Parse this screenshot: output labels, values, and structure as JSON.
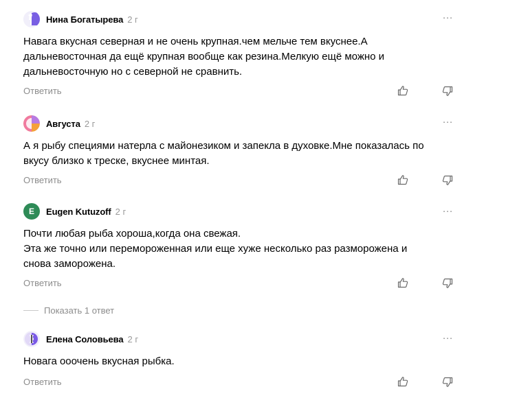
{
  "comments": [
    {
      "author": "Нина Богатырева",
      "time": "2 г",
      "lines": [
        "Навага вкусная северная и не очень крупная.чем мельче тем вкуснее.А",
        "дальневосточная да ещё крупная вообще как резина.Мелкую ещё можно и",
        "дальневосточную но с северной не сравнить."
      ],
      "reply_label": "Ответить",
      "more_label": "···"
    },
    {
      "author": "Августа",
      "time": "2 г",
      "lines": [
        "А я рыбу специями натерла с майонезиком и запекла в духовке.Мне показалась по",
        "вкусу близко к треске, вкуснее минтая."
      ],
      "reply_label": "Ответить",
      "more_label": "···"
    },
    {
      "author": "Eugen Kutuzoff",
      "time": "2 г",
      "avatar_letter": "E",
      "lines": [
        "Почти любая рыба хороша,когда она свежая.",
        "Эта же точно или перемороженная или еще хуже несколько раз разморожена и",
        "снова заморожена."
      ],
      "reply_label": "Ответить",
      "more_label": "···",
      "show_replies_label": "Показать 1 ответ"
    },
    {
      "author": "Елена Соловьева",
      "time": "2 г",
      "lines": [
        "Новага ооочень вкусная рыбка."
      ],
      "reply_label": "Ответить",
      "more_label": "···"
    }
  ],
  "colors": {
    "author_text": "#000000",
    "muted_text": "#8c8c8c",
    "time_text": "#999999",
    "avatar_green": "#2e8b57",
    "avatar_purple": "#6b4fe0",
    "avatar_pink": "#f07aa0",
    "avatar_orange": "#f4a13a"
  },
  "icons": [
    "like-icon",
    "dislike-icon",
    "more-icon"
  ]
}
